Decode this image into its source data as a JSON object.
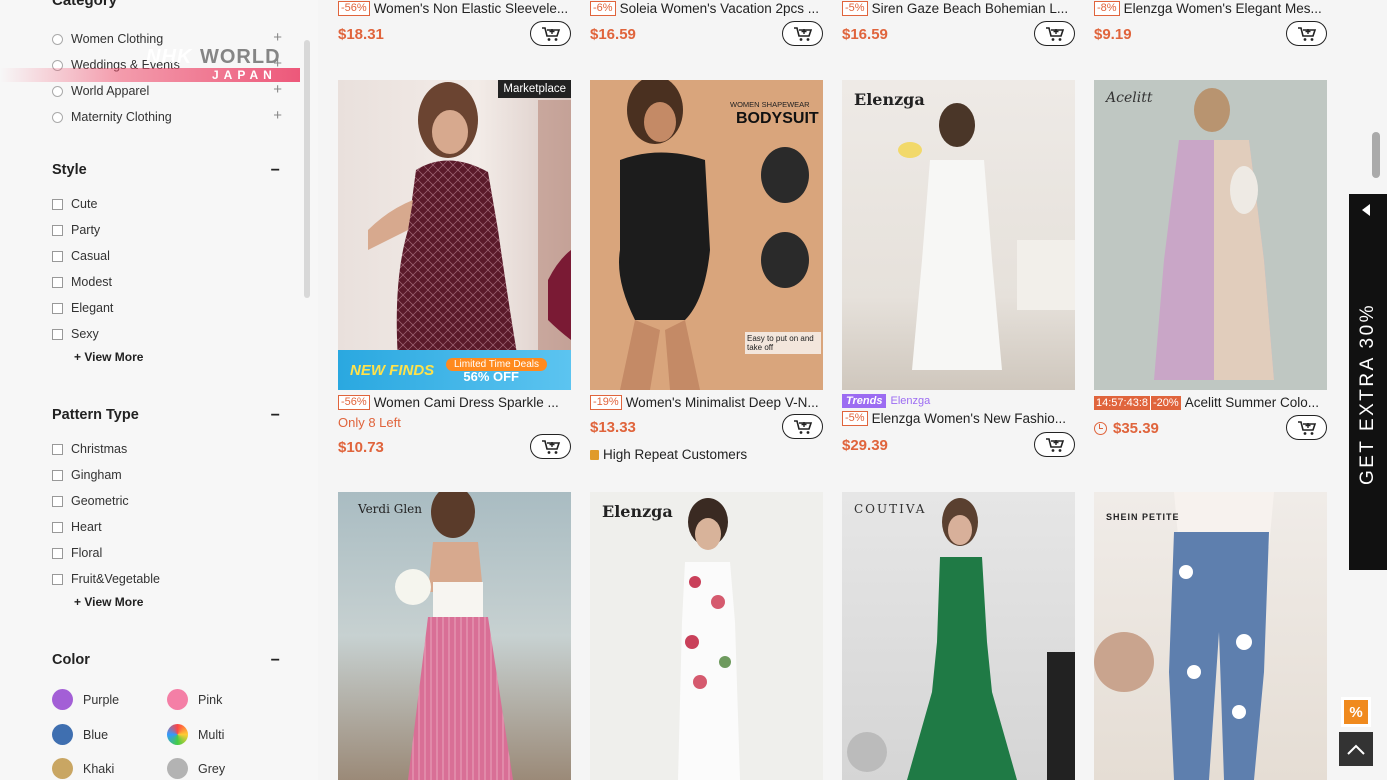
{
  "overlay": {
    "logo_nhk": "NHK",
    "logo_world": "WORLD",
    "logo_japan": "JAPAN"
  },
  "sidebar": {
    "category_title": "Category",
    "categories": [
      {
        "label": "Women Clothing"
      },
      {
        "label": "Weddings & Events"
      },
      {
        "label": "World Apparel"
      },
      {
        "label": "Maternity Clothing"
      }
    ],
    "style": {
      "title": "Style",
      "items": [
        "Cute",
        "Party",
        "Casual",
        "Modest",
        "Elegant",
        "Sexy"
      ],
      "view_more": "+ View More"
    },
    "pattern": {
      "title": "Pattern Type",
      "items": [
        "Christmas",
        "Gingham",
        "Geometric",
        "Heart",
        "Floral",
        "Fruit&Vegetable"
      ],
      "view_more": "+ View More"
    },
    "color": {
      "title": "Color",
      "items": [
        {
          "label": "Purple",
          "hex": "#a35fd6"
        },
        {
          "label": "Pink",
          "hex": "#f47fa6"
        },
        {
          "label": "Blue",
          "hex": "#3f6fb0"
        },
        {
          "label": "Multi",
          "hex": "multi"
        },
        {
          "label": "Khaki",
          "hex": "#c9a663"
        },
        {
          "label": "Grey",
          "hex": "#b3b3b3"
        }
      ]
    }
  },
  "products_top": [
    {
      "discount": "-56%",
      "title": "Women's Non Elastic Sleevele...",
      "price": "$18.31"
    },
    {
      "discount": "-6%",
      "title": "Soleia Women's Vacation 2pcs ...",
      "price": "$16.59"
    },
    {
      "discount": "-5%",
      "title": "Siren Gaze Beach Bohemian L...",
      "price": "$16.59"
    },
    {
      "discount": "-8%",
      "title": "Elenzga Women's Elegant Mes...",
      "price": "$9.19"
    }
  ],
  "products_mid": [
    {
      "badge": "Marketplace",
      "promo_main": "NEW FINDS",
      "promo_tag": "Limited Time Deals",
      "promo_off": "56% OFF",
      "discount": "-56%",
      "title": "Women Cami Dress Sparkle ...",
      "stock": "Only 8 Left",
      "price": "$10.73"
    },
    {
      "img_head": "WOMEN SHAPEWEAR",
      "img_title": "BODYSUIT",
      "img_note": "Easy to put on and take off",
      "discount": "-19%",
      "title": "Women's Minimalist Deep V-N...",
      "price": "$13.33",
      "repeat": "High Repeat Customers"
    },
    {
      "brand": "Elenzga",
      "trend_tag": "Trends",
      "trend_store": "Elenzga",
      "discount": "-5%",
      "title": "Elenzga Women's New Fashio...",
      "price": "$29.39"
    },
    {
      "brand": "Acelitt",
      "timer": "14:57:43:8",
      "discount": "-20%",
      "title": "Acelitt Summer Colo...",
      "price": "$35.39"
    }
  ],
  "products_bottom": [
    {
      "brand": "Verdi Glen"
    },
    {
      "brand": "Elenzga"
    },
    {
      "brand": "COUTIVA"
    },
    {
      "brand": "SHEIN PETITE"
    }
  ],
  "right": {
    "extra_label": "GET EXTRA 30%",
    "percent_icon": "%"
  },
  "colors": {
    "accent": "#e0643c",
    "trend": "#9c6cf2",
    "dark": "#111111"
  }
}
